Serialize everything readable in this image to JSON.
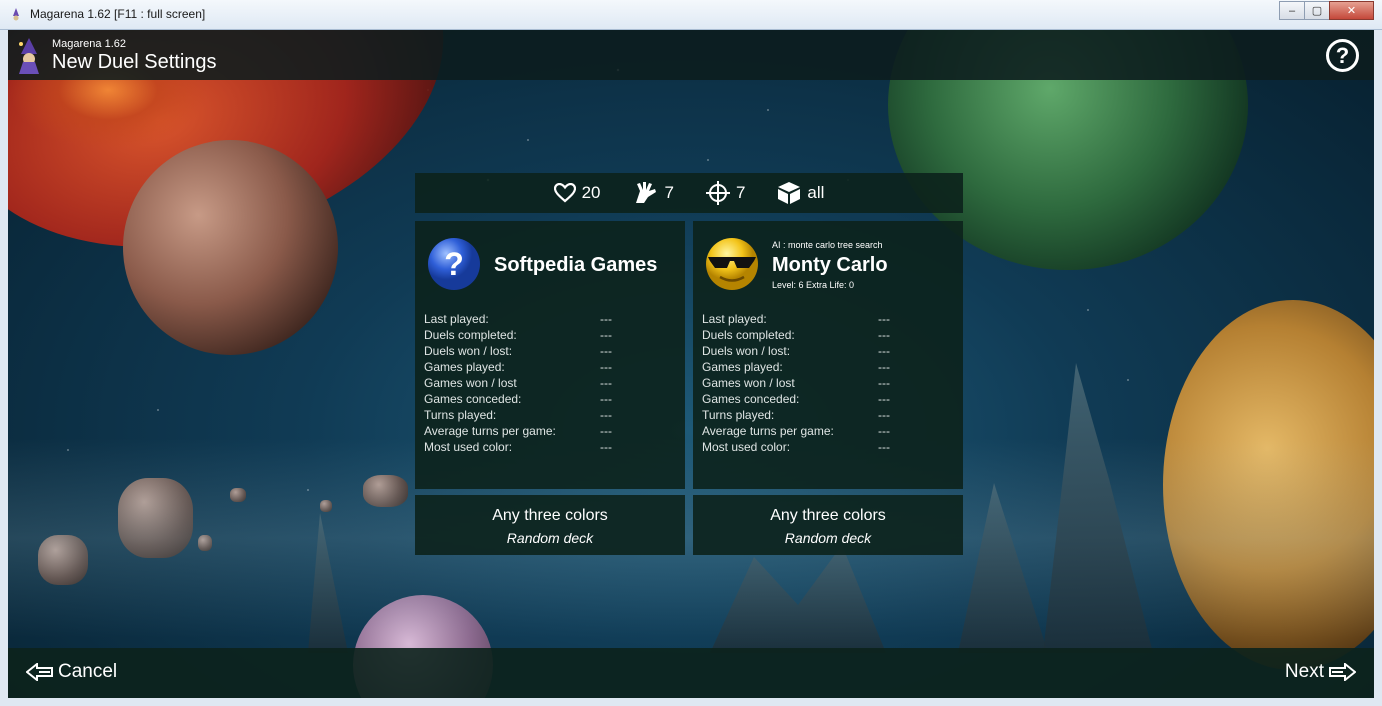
{
  "window": {
    "title": "Magarena 1.62   [F11 : full screen]",
    "minimize": "–",
    "maximize": "▢",
    "close": "✕"
  },
  "header": {
    "app_name": "Magarena 1.62",
    "screen_title": "New Duel Settings",
    "help": "?"
  },
  "settings": {
    "life": "20",
    "hand": "7",
    "target": "7",
    "cube": "all"
  },
  "players": [
    {
      "name": "Softpedia Games",
      "avatar": "question-mark-avatar",
      "stats": [
        {
          "label": "Last played:",
          "value": "---"
        },
        {
          "label": "Duels completed:",
          "value": "---"
        },
        {
          "label": "Duels won / lost:",
          "value": "---"
        },
        {
          "label": "Games played:",
          "value": "---"
        },
        {
          "label": "Games won / lost",
          "value": "---"
        },
        {
          "label": "Games conceded:",
          "value": "---"
        },
        {
          "label": "Turns played:",
          "value": "---"
        },
        {
          "label": "Average turns per game:",
          "value": "---"
        },
        {
          "label": "Most used color:",
          "value": "---"
        }
      ],
      "deck_colors": "Any three colors",
      "deck_type": "Random deck"
    },
    {
      "name": "Monty Carlo",
      "ai": "AI : monte carlo tree search",
      "level": "Level: 6  Extra Life: 0",
      "avatar": "sunglasses-smiley-avatar",
      "stats": [
        {
          "label": "Last played:",
          "value": "---"
        },
        {
          "label": "Duels completed:",
          "value": "---"
        },
        {
          "label": "Duels won / lost:",
          "value": "---"
        },
        {
          "label": "Games played:",
          "value": "---"
        },
        {
          "label": "Games won / lost",
          "value": "---"
        },
        {
          "label": "Games conceded:",
          "value": "---"
        },
        {
          "label": "Turns played:",
          "value": "---"
        },
        {
          "label": "Average turns per game:",
          "value": "---"
        },
        {
          "label": "Most used color:",
          "value": "---"
        }
      ],
      "deck_colors": "Any three colors",
      "deck_type": "Random deck"
    }
  ],
  "footer": {
    "cancel": "Cancel",
    "next": "Next"
  }
}
